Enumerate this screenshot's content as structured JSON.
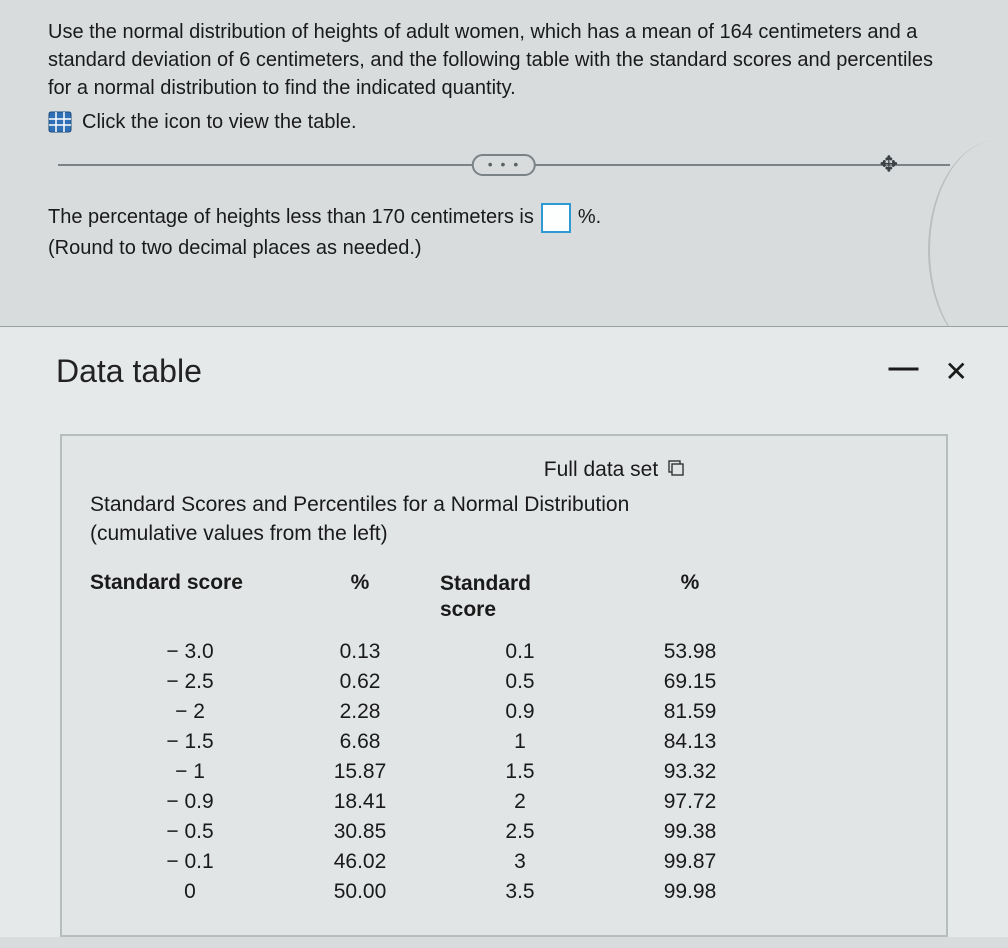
{
  "question": {
    "text": "Use the normal distribution of heights of adult women, which has a mean of 164 centimeters and a standard deviation of 6 centimeters, and the following table with the standard scores and percentiles for a normal distribution to find the indicated quantity.",
    "link_text": "Click the icon to view the table."
  },
  "ellipsis": "• • •",
  "answer": {
    "prefix": "The percentage of heights less than 170 centimeters is",
    "suffix": "%.",
    "hint": "(Round to two decimal places as needed.)"
  },
  "modal": {
    "title": "Data table",
    "full_data_label": "Full data set",
    "caption_line1": "Standard Scores and Percentiles for a Normal Distribution",
    "caption_line2": "(cumulative values from the left)",
    "headers": {
      "c1": "Standard score",
      "c2": "%",
      "c3a": "Standard",
      "c3b": "score",
      "c4": "%"
    }
  },
  "chart_data": {
    "type": "table",
    "title": "Standard Scores and Percentiles for a Normal Distribution (cumulative values from the left)",
    "columns": [
      "Standard score",
      "%",
      "Standard score",
      "%"
    ],
    "rows": [
      {
        "s1": "− 3.0",
        "p1": "0.13",
        "s2": "0.1",
        "p2": "53.98"
      },
      {
        "s1": "− 2.5",
        "p1": "0.62",
        "s2": "0.5",
        "p2": "69.15"
      },
      {
        "s1": "− 2",
        "p1": "2.28",
        "s2": "0.9",
        "p2": "81.59"
      },
      {
        "s1": "− 1.5",
        "p1": "6.68",
        "s2": "1",
        "p2": "84.13"
      },
      {
        "s1": "− 1",
        "p1": "15.87",
        "s2": "1.5",
        "p2": "93.32"
      },
      {
        "s1": "− 0.9",
        "p1": "18.41",
        "s2": "2",
        "p2": "97.72"
      },
      {
        "s1": "− 0.5",
        "p1": "30.85",
        "s2": "2.5",
        "p2": "99.38"
      },
      {
        "s1": "− 0.1",
        "p1": "46.02",
        "s2": "3",
        "p2": "99.87"
      },
      {
        "s1": "0",
        "p1": "50.00",
        "s2": "3.5",
        "p2": "99.98"
      }
    ]
  }
}
